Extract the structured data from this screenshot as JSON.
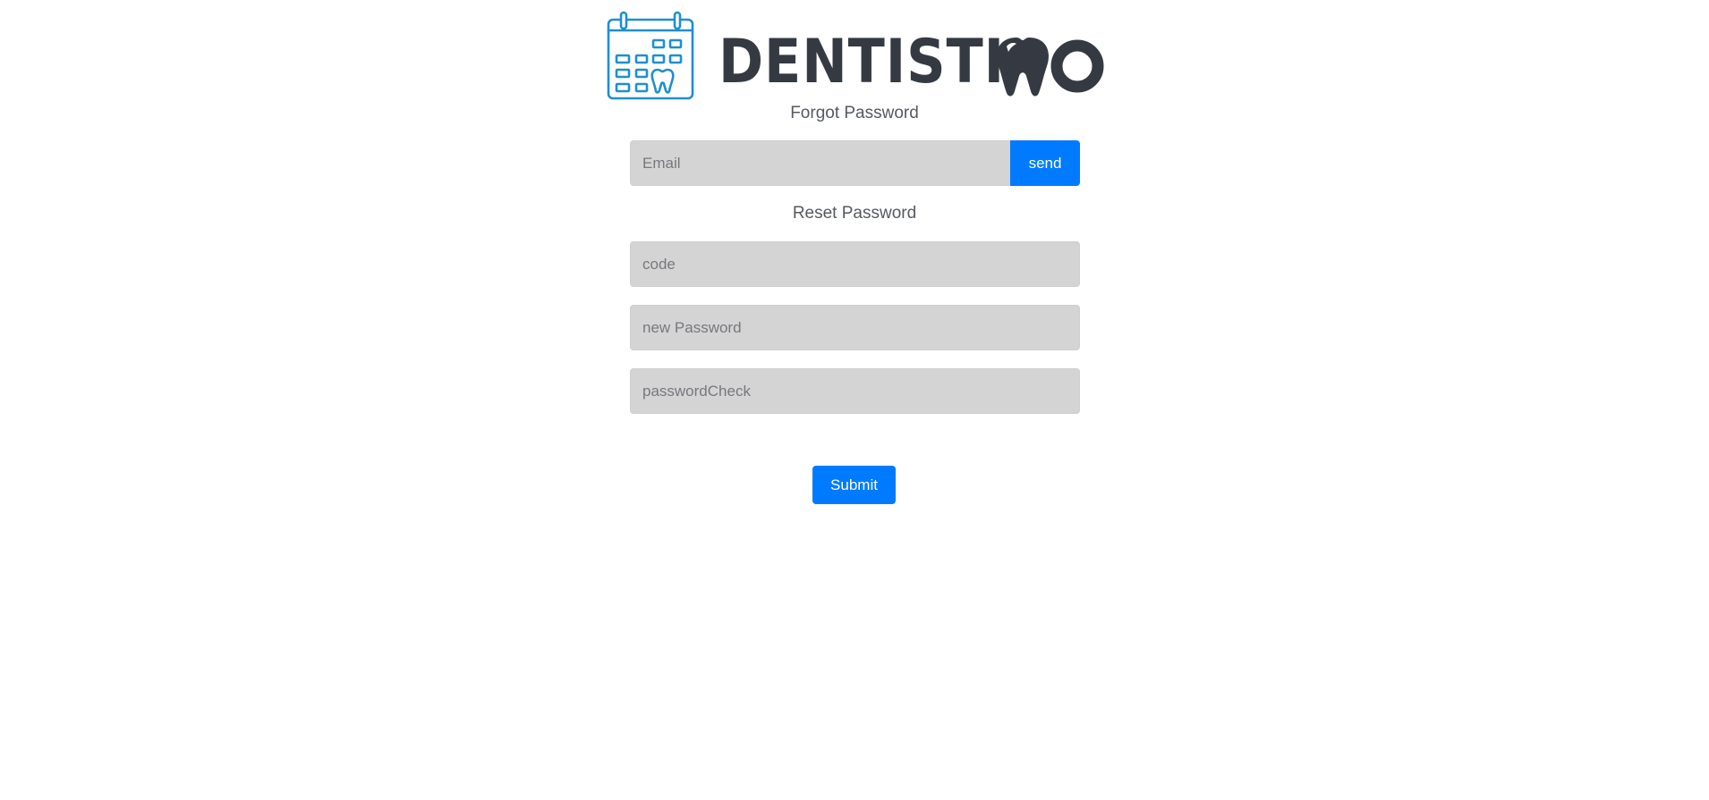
{
  "brand": {
    "name": "DENTISTIMO",
    "colors": {
      "calendar": "#1e8fd0",
      "wordmark": "#353a42"
    }
  },
  "forgot": {
    "title": "Forgot Password",
    "email_placeholder": "Email",
    "send_label": "send"
  },
  "reset": {
    "title": "Reset Password",
    "code_placeholder": "code",
    "new_password_placeholder": "new Password",
    "password_check_placeholder": "passwordCheck",
    "submit_label": "Submit"
  },
  "colors": {
    "primary": "#007bff",
    "input_bg": "#d5d4d5",
    "text": "#555a60"
  }
}
